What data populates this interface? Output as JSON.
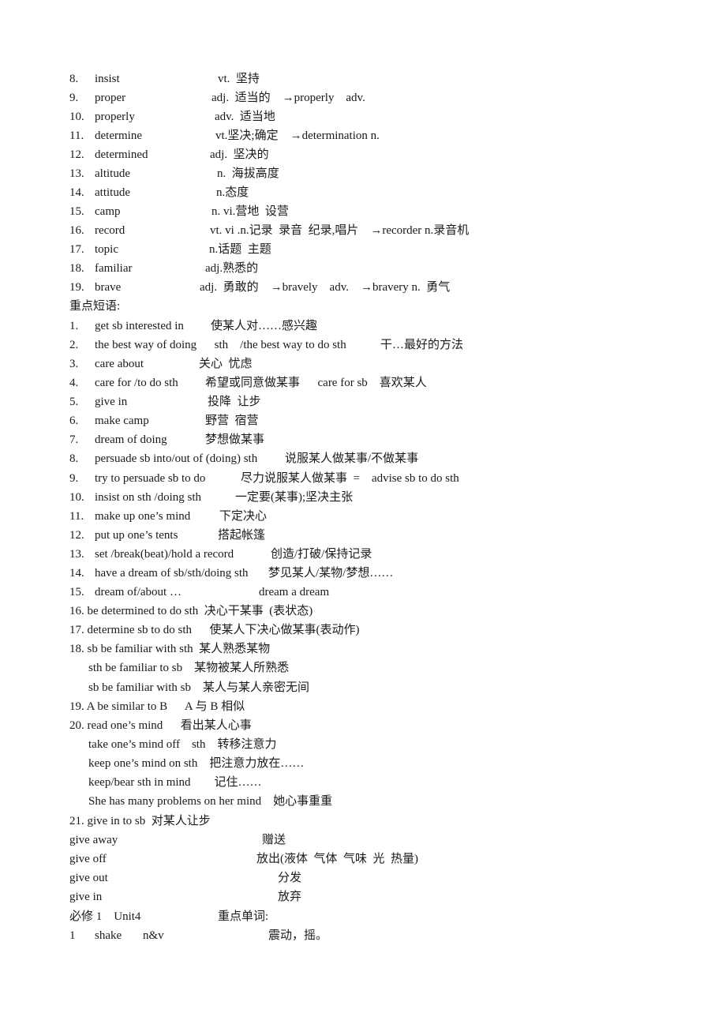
{
  "vocab_words": [
    {
      "num": "8.",
      "word": "insist",
      "def": "vt.  坚持"
    },
    {
      "num": "9.",
      "word": "proper",
      "def": "adj.  适当的    →properly    adv."
    },
    {
      "num": "10.",
      "word": "properly",
      "def": "adv.  适当地"
    },
    {
      "num": "11.",
      "word": "determine",
      "def": "vt.坚决;确定    →determination n."
    },
    {
      "num": "12.",
      "word": "determined",
      "def": "adj.  坚决的"
    },
    {
      "num": "13.",
      "word": "altitude",
      "def": "n.  海拔高度"
    },
    {
      "num": "14.",
      "word": "attitude",
      "def": "n.态度"
    },
    {
      "num": "15.",
      "word": "camp",
      "def": "n. vi.营地  设营"
    },
    {
      "num": "16.",
      "word": "record",
      "def": "vt. vi .n.记录  录音  纪录,唱片    →recorder n.录音机"
    },
    {
      "num": "17.",
      "word": "topic",
      "def": "n.话题  主题"
    },
    {
      "num": "18.",
      "word": "familiar",
      "def": "adj.熟悉的"
    },
    {
      "num": "19.",
      "word": "brave",
      "def": "adj.  勇敢的    →bravely    adv.    →bravery n.  勇气"
    }
  ],
  "phrases_heading": "重点短语:",
  "phrases": [
    {
      "num": "1.",
      "phrase": "get sb interested in",
      "meaning": "使某人对……感兴趣"
    },
    {
      "num": "2.",
      "phrase": "the best way of doing      sth    /the best way to do sth",
      "meaning": "干…最好的方法"
    },
    {
      "num": "3.",
      "phrase": "care about",
      "meaning": "关心  忧虑"
    },
    {
      "num": "4.",
      "phrase": "care for /to do sth",
      "meaning": "希望或同意做某事      care for sb    喜欢某人"
    },
    {
      "num": "5.",
      "phrase": "give in",
      "meaning": "投降  让步"
    },
    {
      "num": "6.",
      "phrase": "make camp",
      "meaning": "野营  宿营"
    },
    {
      "num": "7.",
      "phrase": "dream of doing",
      "meaning": "梦想做某事"
    },
    {
      "num": "8.",
      "phrase": "persuade sb into/out of (doing) sth",
      "meaning": "说服某人做某事/不做某事"
    },
    {
      "num": "9.",
      "phrase": "try to persuade sb to do",
      "meaning": "尽力说服某人做某事  =    advise sb to do sth"
    },
    {
      "num": "10.",
      "phrase": "insist on sth /doing sth",
      "meaning": "一定要(某事);坚决主张"
    },
    {
      "num": "11.",
      "phrase": "make up one’s mind",
      "meaning": "下定决心"
    },
    {
      "num": "12.",
      "phrase": "put up one’s tents",
      "meaning": "搭起帐篷"
    },
    {
      "num": "13.",
      "phrase": "set /break(beat)/hold a record",
      "meaning": "创造/打破/保持记录"
    },
    {
      "num": "14.",
      "phrase": "have a dream of sb/sth/doing sth",
      "meaning": "梦见某人/某物/梦想……"
    },
    {
      "num": "15.",
      "phrase": "dream of/about …",
      "meaning": "dream a dream"
    }
  ],
  "extra_lines": [
    {
      "text": "16. be determined to do sth  决心干某事  (表状态)",
      "indent": false
    },
    {
      "text": "17. determine sb to do sth      使某人下决心做某事(表动作)",
      "indent": false
    },
    {
      "text": "18. sb be familiar with sth  某人熟悉某物",
      "indent": false
    },
    {
      "text": "sth be familiar to sb    某物被某人所熟悉",
      "indent": true
    },
    {
      "text": "sb be familiar with sb    某人与某人亲密无间",
      "indent": true
    },
    {
      "text": "19. A be similar to B      A 与 B 相似",
      "indent": false
    },
    {
      "text": "20. read one’s mind      看出某人心事",
      "indent": false
    },
    {
      "text": "take one’s mind off    sth    转移注意力",
      "indent": true
    },
    {
      "text": "keep one’s mind on sth    把注意力放在……",
      "indent": true
    },
    {
      "text": "keep/bear sth in mind        记住……",
      "indent": true
    },
    {
      "text": "She has many problems on her mind    她心事重重",
      "indent": true
    },
    {
      "text": "21. give in to sb  对某人让步",
      "indent": false
    }
  ],
  "give_phrases": [
    {
      "phrase": "give away",
      "meaning": "赠送"
    },
    {
      "phrase": "give off",
      "meaning": "放出(液体  气体  气味  光  热量)"
    },
    {
      "phrase": "give out",
      "meaning": "分发"
    },
    {
      "phrase": "give in",
      "meaning": "放弃"
    }
  ],
  "unit_header": {
    "book": "必修 1    Unit4",
    "label": "重点单词:"
  },
  "unit_words": [
    {
      "num": "1",
      "word": "shake",
      "pos": "n&v",
      "meaning": "震动，摇。"
    }
  ]
}
